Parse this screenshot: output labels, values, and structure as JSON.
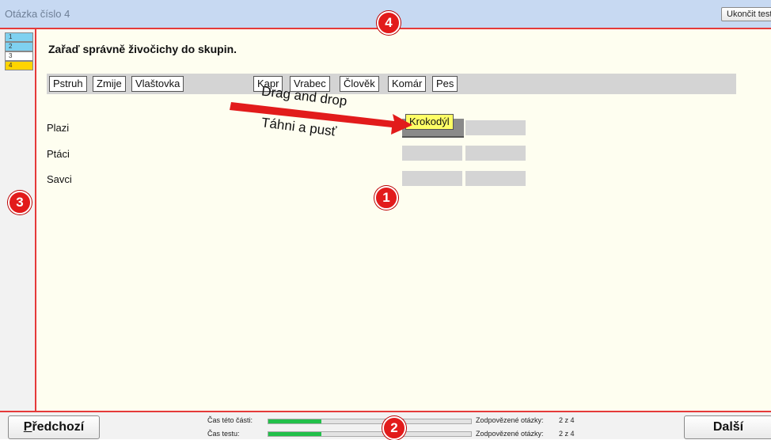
{
  "header": {
    "title": "Otázka číslo 4",
    "end_test_label": "Ukončit test"
  },
  "question_nav": {
    "items": [
      {
        "label": "1",
        "state": "done"
      },
      {
        "label": "2",
        "state": "done"
      },
      {
        "label": "3",
        "state": "open"
      },
      {
        "label": "4",
        "state": "active"
      }
    ]
  },
  "question": {
    "text": "Zařaď správně živočichy do skupin.",
    "pool_words": [
      "Pstruh",
      "Zmije",
      "Vlaštovka",
      "Kapr",
      "Vrabec",
      "Člověk",
      "Komár",
      "Pes"
    ],
    "categories": [
      {
        "label": "Plazi",
        "items": [
          "Krokodýl"
        ]
      },
      {
        "label": "Ptáci",
        "items": []
      },
      {
        "label": "Savci",
        "items": []
      }
    ]
  },
  "annotation": {
    "drag_en": "Drag and drop",
    "drag_cz": "Táhni a pusť",
    "badges": [
      "1",
      "2",
      "3",
      "4"
    ],
    "color": "#e21b1b"
  },
  "footer": {
    "prev_label_first": "P",
    "prev_label_rest": "ředchozí",
    "next_label": "Další",
    "section_time_label": "Čas této části:",
    "test_time_label": "Čas testu:",
    "answered_label": "Zodpovězené otázky:",
    "answered_value": "2 z 4",
    "section_progress": 0.26,
    "test_progress": 0.26,
    "progress_color": "#22c04a"
  }
}
